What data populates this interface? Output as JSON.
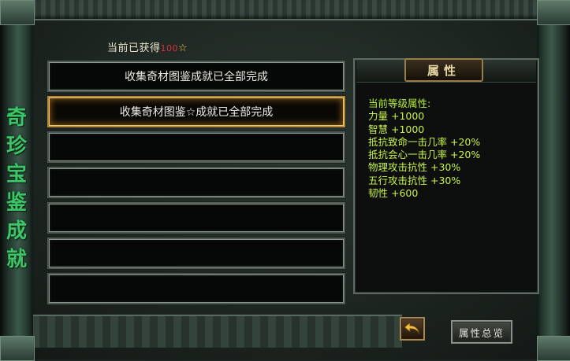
{
  "side_title": [
    "奇",
    "珍",
    "宝",
    "鉴",
    "成",
    "就"
  ],
  "obtained": {
    "label": "当前已获得",
    "count": "100",
    "star": "☆"
  },
  "slots": [
    {
      "text": "收集奇材图鉴成就已全部完成",
      "selected": false
    },
    {
      "text": "收集奇材图鉴☆成就已全部完成",
      "selected": true
    },
    {
      "text": "",
      "selected": false
    },
    {
      "text": "",
      "selected": false
    },
    {
      "text": "",
      "selected": false
    },
    {
      "text": "",
      "selected": false
    },
    {
      "text": "",
      "selected": false
    }
  ],
  "attributes_panel": {
    "tab_label": "属性",
    "heading": "当前等级属性:",
    "lines": [
      "力量 +1000",
      "智慧 +1000",
      "抵抗致命一击几率 +20%",
      "抵抗会心一击几率 +20%",
      "物理攻击抗性 +30%",
      "五行攻击抗性 +30%",
      "韧性 +600"
    ]
  },
  "buttons": {
    "back_icon": "return-arrow-icon",
    "overview_label": "属性总览"
  },
  "colors": {
    "attribute_text": "#c8f24a",
    "title_green": "#3ec56a",
    "count_red": "#e0303a",
    "star_yellow": "#f2d64a"
  }
}
